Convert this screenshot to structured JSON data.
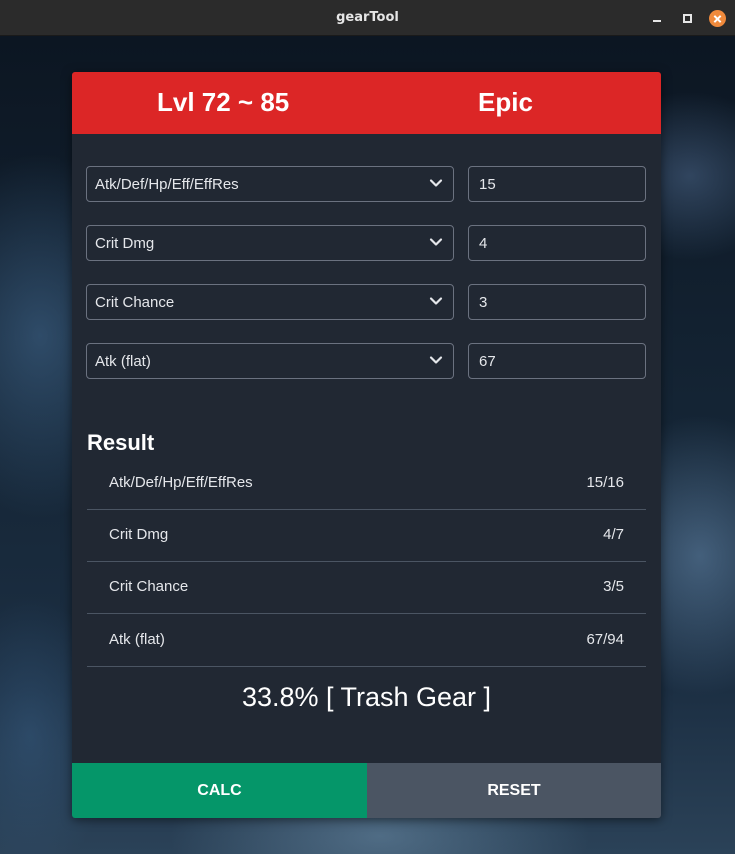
{
  "window": {
    "title": "gearTool"
  },
  "header": {
    "level_range": "Lvl 72 ~ 85",
    "rarity": "Epic",
    "color": "#dc2626"
  },
  "substats": [
    {
      "stat": "Atk/Def/Hp/Eff/EffRes",
      "value": "15"
    },
    {
      "stat": "Crit Dmg",
      "value": "4"
    },
    {
      "stat": "Crit Chance",
      "value": "3"
    },
    {
      "stat": "Atk (flat)",
      "value": "67"
    }
  ],
  "result": {
    "heading": "Result",
    "rows": [
      {
        "name": "Atk/Def/Hp/Eff/EffRes",
        "score": "15/16"
      },
      {
        "name": "Crit Dmg",
        "score": "4/7"
      },
      {
        "name": "Crit Chance",
        "score": "3/5"
      },
      {
        "name": "Atk (flat)",
        "score": "67/94"
      }
    ],
    "summary": "33.8% [ Trash Gear ]"
  },
  "buttons": {
    "calc_label": "CALC",
    "reset_label": "RESET",
    "calc_color": "#059669",
    "reset_color": "#4b5563"
  },
  "icons": {
    "dropdown": "chevron-down-icon",
    "close": "close-icon",
    "minimize": "minimize-icon",
    "maximize": "maximize-icon"
  }
}
